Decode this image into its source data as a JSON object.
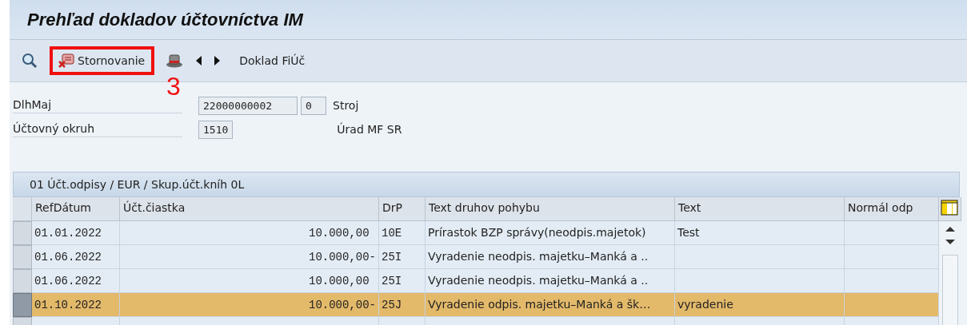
{
  "window": {
    "title": "Prehľad dokladov účtovníctva IM"
  },
  "toolbar": {
    "items": [
      {
        "kind": "search"
      },
      {
        "kind": "button",
        "label": "Stornovanie",
        "highlighted": true,
        "annotation": "3"
      },
      {
        "kind": "hat"
      },
      {
        "kind": "prev"
      },
      {
        "kind": "next"
      },
      {
        "kind": "text",
        "label": "Doklad FiÚč"
      }
    ]
  },
  "form": {
    "rows": [
      {
        "label": "DlhMaj",
        "fields": [
          "22000000002",
          "0"
        ],
        "description": "Stroj"
      },
      {
        "label": "Účtovný okruh",
        "fields": [
          "1510"
        ],
        "description": "Úrad MF SR"
      }
    ]
  },
  "table": {
    "title": "01 Účt.odpisy / EUR / Skup.účt.kníh 0L",
    "columns": [
      "RefDátum",
      "Účt.čiastka",
      "DrP",
      "Text druhov pohybu",
      "Text",
      "Normál odp"
    ],
    "rows": [
      {
        "cells": [
          "01.01.2022",
          "10.000,00 ",
          "10E",
          "Prírastok BZP správy(neodpis.majetok)",
          "Test",
          ""
        ],
        "selected": false
      },
      {
        "cells": [
          "01.06.2022",
          "10.000,00-",
          "25I",
          "Vyradenie neodpis. majetku–Manká a ..",
          "",
          ""
        ],
        "selected": false
      },
      {
        "cells": [
          "01.06.2022",
          "10.000,00 ",
          "25I",
          "Vyradenie neodpis. majetku–Manká a ..",
          "",
          ""
        ],
        "selected": false
      },
      {
        "cells": [
          "01.10.2022",
          "10.000,00-",
          "25J",
          "Vyradenie odpis. majetku–Manká a šk…",
          "vyradenie",
          ""
        ],
        "selected": true
      }
    ]
  }
}
